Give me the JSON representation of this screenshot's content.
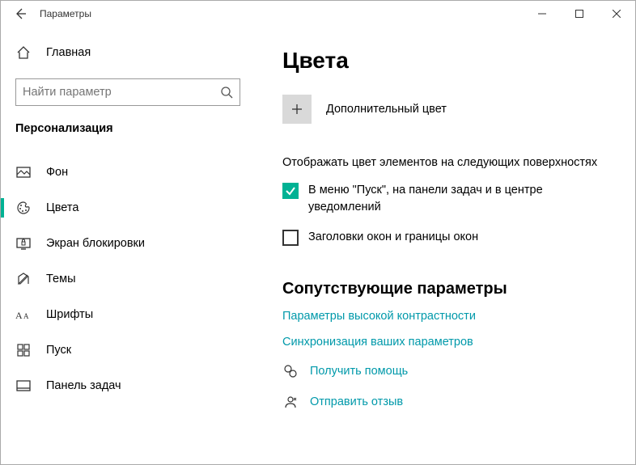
{
  "window": {
    "title": "Параметры"
  },
  "sidebar": {
    "home": "Главная",
    "search_placeholder": "Найти параметр",
    "section": "Персонализация",
    "items": [
      {
        "label": "Фон"
      },
      {
        "label": "Цвета"
      },
      {
        "label": "Экран блокировки"
      },
      {
        "label": "Темы"
      },
      {
        "label": "Шрифты"
      },
      {
        "label": "Пуск"
      },
      {
        "label": "Панель задач"
      }
    ]
  },
  "main": {
    "title": "Цвета",
    "add_color": "Дополнительный цвет",
    "show_on_label": "Отображать цвет элементов на следующих поверхностях",
    "checks": [
      {
        "label": "В меню \"Пуск\", на панели задач и в центре уведомлений"
      },
      {
        "label": "Заголовки окон и границы окон"
      }
    ],
    "related_title": "Сопутствующие параметры",
    "links": [
      "Параметры высокой контрастности",
      "Синхронизация ваших параметров"
    ],
    "help": "Получить помощь",
    "feedback": "Отправить отзыв"
  }
}
